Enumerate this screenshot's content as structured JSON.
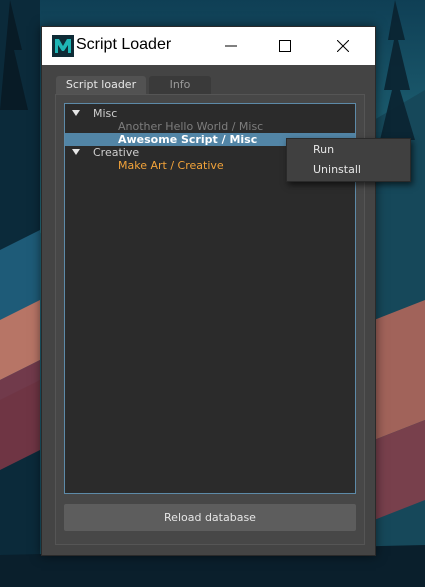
{
  "window": {
    "title": "Script Loader",
    "icon": "maya-m-icon"
  },
  "tabs": [
    {
      "label": "Script loader",
      "active": true
    },
    {
      "label": "Info",
      "active": false
    }
  ],
  "tree": {
    "categories": [
      {
        "label": "Misc",
        "expanded": true,
        "items": [
          {
            "label": "Another Hello World / Misc",
            "style": "dim"
          },
          {
            "label": "Awesome Script / Misc",
            "style": "selected"
          }
        ]
      },
      {
        "label": "Creative",
        "expanded": true,
        "items": [
          {
            "label": "Make Art / Creative",
            "style": "orange"
          }
        ]
      }
    ]
  },
  "buttons": {
    "reload": "Reload database"
  },
  "context_menu": {
    "items": [
      "Run",
      "Uninstall"
    ]
  },
  "colors": {
    "accent_selection": "#5285a6",
    "tree_border": "#5d8aa8",
    "orange_item": "#f2a33a",
    "maya_teal": "#1fb5b5"
  }
}
